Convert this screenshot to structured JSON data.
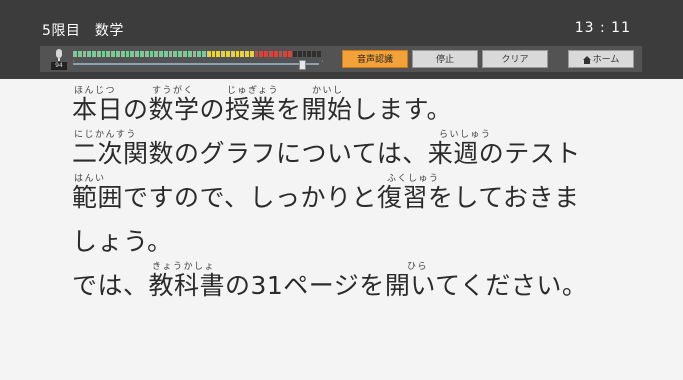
{
  "header": {
    "title": "5限目　数学",
    "time": "13 : 11"
  },
  "toolbar": {
    "mic_level": "94",
    "buttons": {
      "speech": "音声認識",
      "stop": "停止",
      "clear": "クリア",
      "home": "ホーム"
    },
    "slider_fraction": 0.93,
    "meter_segments": {
      "green": 28,
      "yellow": 10,
      "red": 8,
      "dark": 6
    },
    "colors": {
      "accent": "#f3a23a",
      "green": "#7fc89a",
      "yellow": "#e7d23b",
      "red": "#d9433a",
      "dark": "#2f2f2f"
    }
  },
  "text": {
    "lines": [
      {
        "text": "本日の数学の授業を開始します。",
        "ruby": [
          "ほんじつ",
          "すうがく",
          "じゅぎょう",
          "かいし"
        ]
      },
      {
        "text": "二次関数のグラフについては、来週のテスト",
        "ruby": [
          "にじかんすう",
          "らいしゅう"
        ]
      },
      {
        "text": "範囲ですので、しっかりと復習をしておきま",
        "ruby": [
          "はんい",
          "ふくしゅう"
        ]
      },
      {
        "text": "しょう。",
        "ruby": []
      },
      {
        "text": "では、教科書の31ページを開いてください。",
        "ruby": [
          "きょうかしょ",
          "ひら"
        ]
      }
    ]
  }
}
